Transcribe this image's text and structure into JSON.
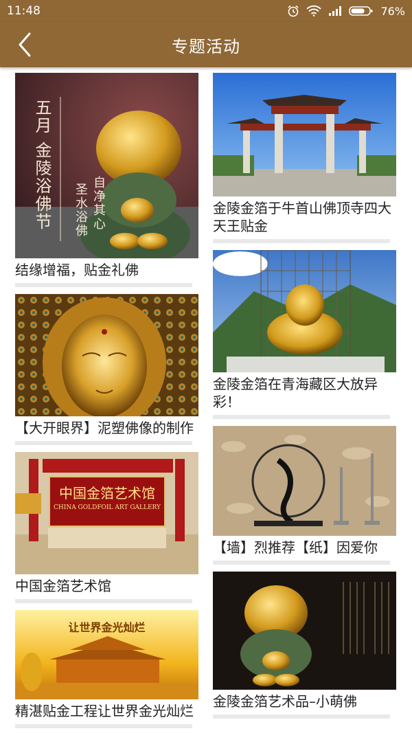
{
  "status_bar": {
    "time": "11:48",
    "battery": "76%"
  },
  "header": {
    "title": "专题活动"
  },
  "left_column": [
    {
      "caption": "结缘增福，贴金礼佛",
      "overlay": [
        "五月",
        "金陵浴佛节"
      ],
      "overlay2": [
        "自净其心",
        "圣水浴佛"
      ]
    },
    {
      "caption": "【大开眼界】泥塑佛像的制作"
    },
    {
      "caption": "中国金箔艺术馆",
      "sign_cn": "中国金箔艺术馆",
      "sign_en": "CHINA GOLDFOIL ART GALLERY"
    },
    {
      "caption": "精湛贴金工程让世界金光灿烂",
      "banner": "让世界金光灿烂"
    }
  ],
  "right_column": [
    {
      "caption": "金陵金箔于牛首山佛顶寺四大天王贴金"
    },
    {
      "caption": "金陵金箔在青海藏区大放异彩！"
    },
    {
      "caption": "【墙】烈推荐【纸】因爱你"
    },
    {
      "caption": "金陵金箔艺术品–小萌佛"
    }
  ],
  "colors": {
    "accent": "#8f6836",
    "divider": "#e9e9e9"
  }
}
